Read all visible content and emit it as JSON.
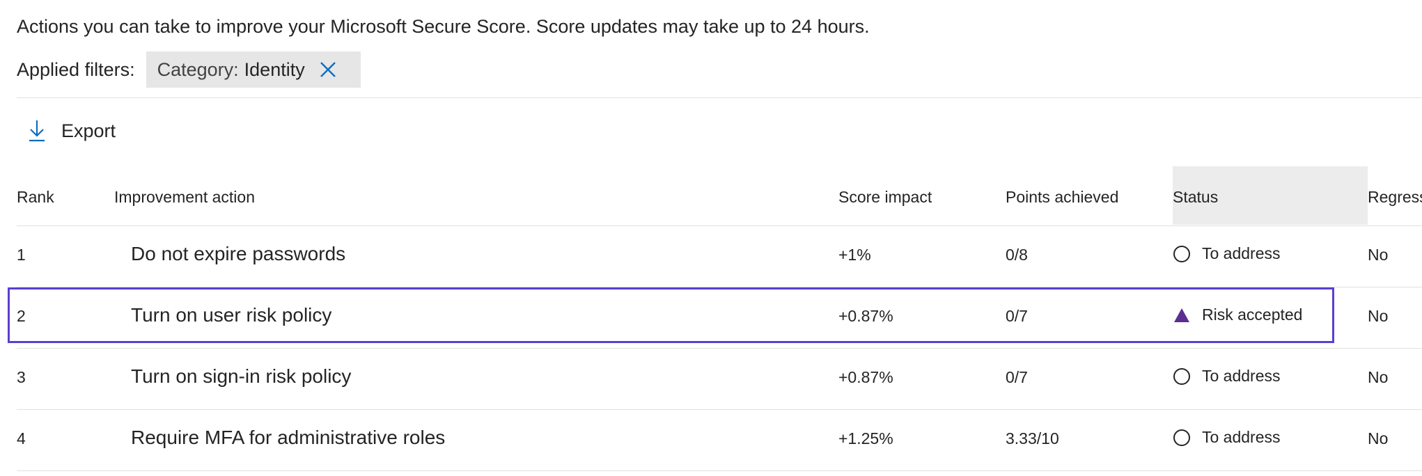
{
  "intro_text": "Actions you can take to improve your Microsoft Secure Score. Score updates may take up to 24 hours.",
  "filters": {
    "label": "Applied filters:",
    "chips": [
      {
        "key": "Category:",
        "value": "Identity",
        "close_icon": "close-icon"
      }
    ]
  },
  "toolbar": {
    "export_label": "Export",
    "export_icon": "download-icon"
  },
  "table": {
    "columns": {
      "rank": "Rank",
      "action": "Improvement action",
      "impact": "Score impact",
      "points": "Points achieved",
      "status": "Status",
      "regressed": "Regress"
    },
    "rows": [
      {
        "rank": "1",
        "action": "Do not expire passwords",
        "impact": "+1%",
        "points": "0/8",
        "status": "To address",
        "status_icon": "circle-icon",
        "regressed": "No"
      },
      {
        "rank": "2",
        "action": "Turn on user risk policy",
        "impact": "+0.87%",
        "points": "0/7",
        "status": "Risk accepted",
        "status_icon": "triangle-icon",
        "regressed": "No"
      },
      {
        "rank": "3",
        "action": "Turn on sign-in risk policy",
        "impact": "+0.87%",
        "points": "0/7",
        "status": "To address",
        "status_icon": "circle-icon",
        "regressed": "No"
      },
      {
        "rank": "4",
        "action": "Require MFA for administrative roles",
        "impact": "+1.25%",
        "points": "3.33/10",
        "status": "To address",
        "status_icon": "circle-icon",
        "regressed": "No"
      }
    ]
  },
  "colors": {
    "accent": "#0f6cbd",
    "highlight_border": "#5b3fd1",
    "risk_accepted_icon": "#5c2e91"
  }
}
